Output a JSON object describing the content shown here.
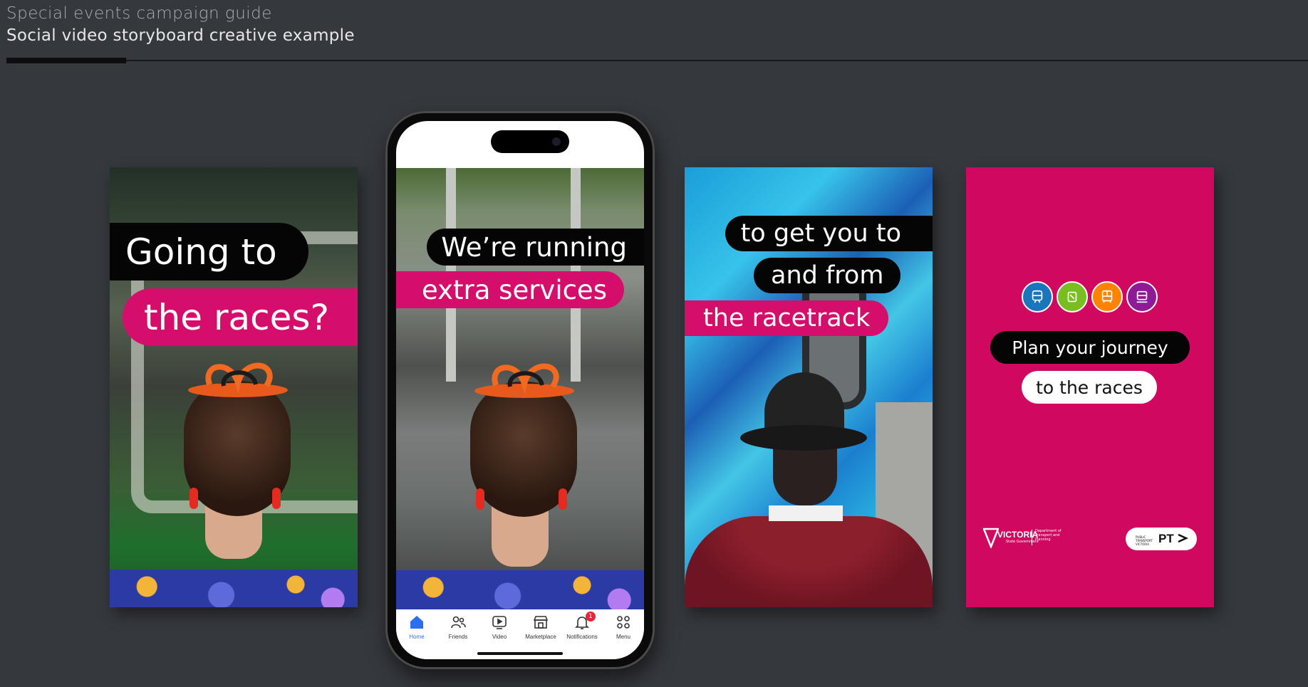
{
  "header": {
    "guide_title": "Special events campaign guide",
    "page_title": "Social video storyboard creative example"
  },
  "frames": [
    {
      "lines": [
        "Going to",
        "the races?"
      ]
    },
    {
      "lines": [
        "We’re running",
        "extra services"
      ]
    },
    {
      "lines": [
        "to get you to",
        "and from",
        "the racetrack"
      ]
    },
    {
      "lines": [
        "Plan your journey",
        "to the races"
      ]
    }
  ],
  "phone": {
    "tabs": [
      {
        "label": "Home",
        "icon": "home-icon"
      },
      {
        "label": "Friends",
        "icon": "friends-icon"
      },
      {
        "label": "Video",
        "icon": "video-icon"
      },
      {
        "label": "Marketplace",
        "icon": "marketplace-icon"
      },
      {
        "label": "Notifications",
        "icon": "bell-icon"
      },
      {
        "label": "Menu",
        "icon": "menu-grid-icon"
      }
    ],
    "notification_count": "1"
  },
  "mode_icons": [
    {
      "icon": "train-icon",
      "color": "#1b75bc"
    },
    {
      "icon": "tram-icon",
      "color": "#78be20"
    },
    {
      "icon": "bus-icon",
      "color": "#ff8200"
    },
    {
      "icon": "regional-train-icon",
      "color": "#8f1a95"
    }
  ],
  "logos": {
    "victoria": "VICTORIA",
    "victoria_sub": "State Government",
    "department": "Department of Transport and Planning",
    "ptv_small": "PUBLIC TRANSPORT VICTORIA",
    "ptv": "PT"
  },
  "colors": {
    "background": "#35383d",
    "brand_pink": "#d60e6b",
    "black": "#050505",
    "active_tab": "#2b6ef2"
  }
}
